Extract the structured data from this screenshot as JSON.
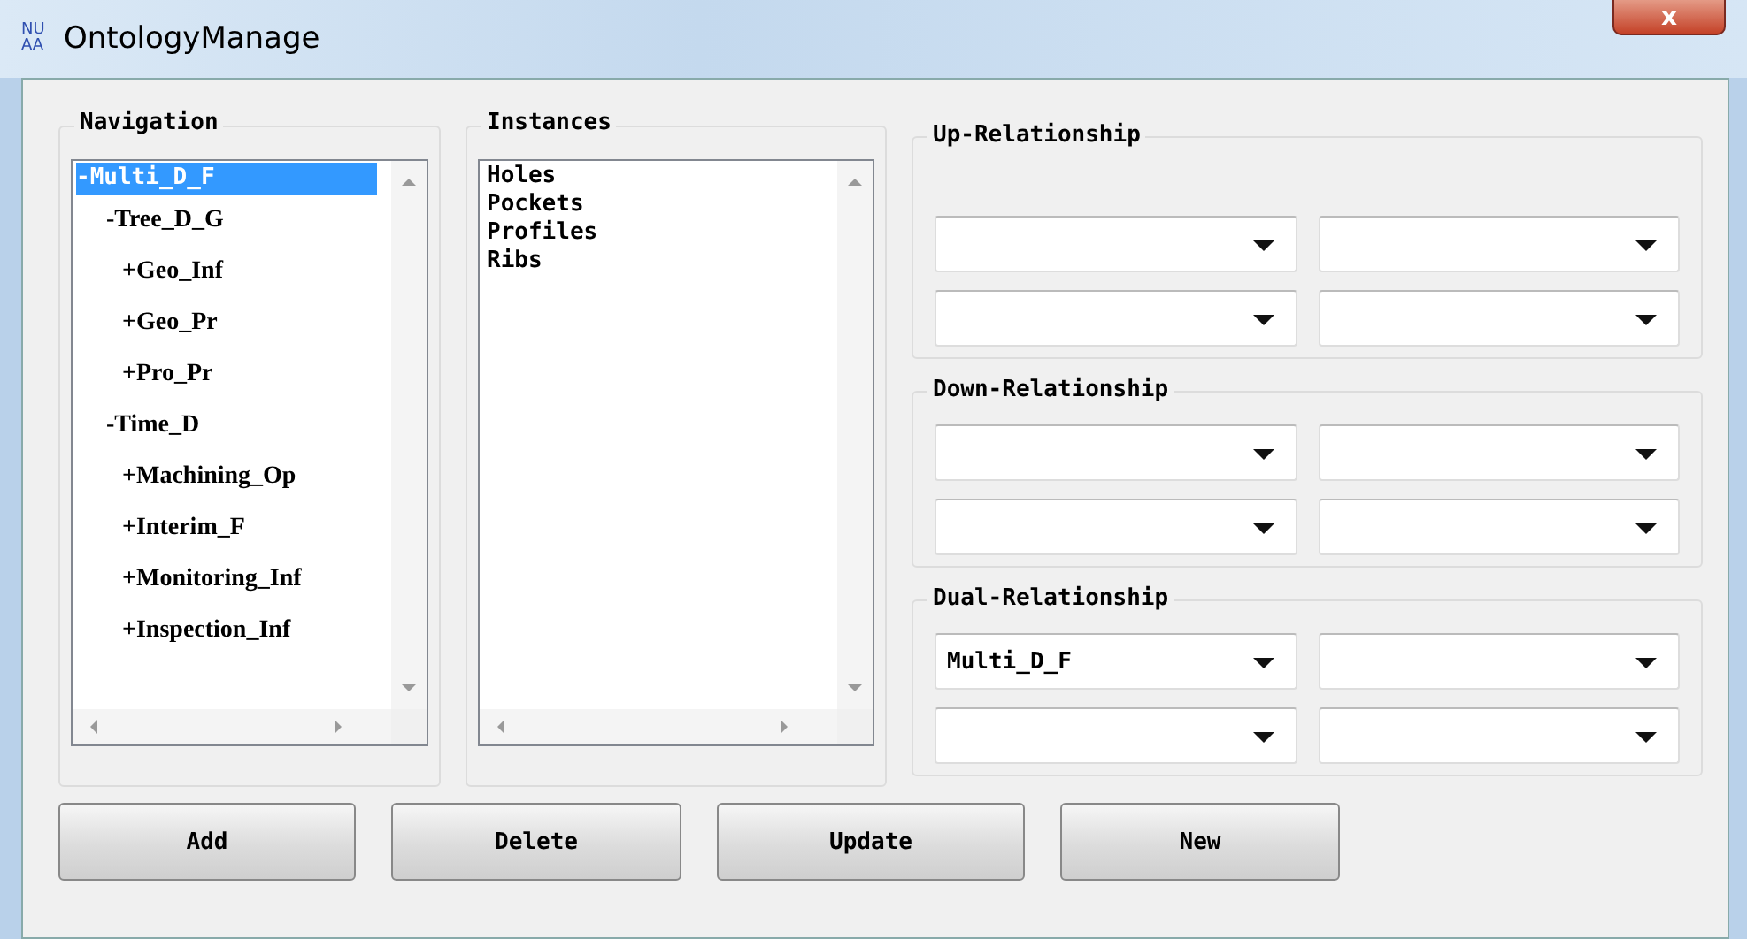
{
  "window": {
    "title": "OntologyManage",
    "logo": "NU\nAA",
    "close": "x"
  },
  "navigation": {
    "title": "Navigation",
    "tree": [
      {
        "label": "-Multi_D_F",
        "selected": true,
        "children": [
          {
            "label": "-Tree_D_G",
            "selected": false,
            "children": [
              {
                "label": "+Geo_Inf",
                "selected": false
              },
              {
                "label": "+Geo_Pr",
                "selected": false
              },
              {
                "label": "+Pro_Pr",
                "selected": false
              }
            ]
          },
          {
            "label": "-Time_D",
            "selected": false,
            "children": [
              {
                "label": "+Machining_Op",
                "selected": false
              },
              {
                "label": "+Interim_F",
                "selected": false
              },
              {
                "label": "+Monitoring_Inf",
                "selected": false
              },
              {
                "label": "+Inspection_Inf",
                "selected": false
              }
            ]
          }
        ]
      }
    ]
  },
  "instances": {
    "title": "Instances",
    "items": [
      "Holes",
      "Pockets",
      "Profiles",
      "Ribs"
    ]
  },
  "relationships": [
    {
      "title": "Up-Relationship",
      "kind": "up",
      "combos": [
        {
          "kind": "combo"
        },
        {
          "kind": "combo"
        },
        {
          "kind": "combo"
        },
        {
          "kind": "combo"
        }
      ]
    },
    {
      "title": "Down-Relationship",
      "kind": "down",
      "combos": [
        {
          "kind": "combo"
        },
        {
          "kind": "combo"
        },
        {
          "kind": "combo"
        },
        {
          "kind": "combo"
        }
      ]
    },
    {
      "title": "Dual-Relationship",
      "kind": "dual",
      "combos": [
        {
          "kind": "combo",
          "value": "Multi_D_F"
        },
        {
          "kind": "combo"
        },
        {
          "kind": "combo"
        },
        {
          "kind": "combo"
        }
      ]
    }
  ],
  "buttons": [
    "Add",
    "Delete",
    "Update",
    "New"
  ]
}
